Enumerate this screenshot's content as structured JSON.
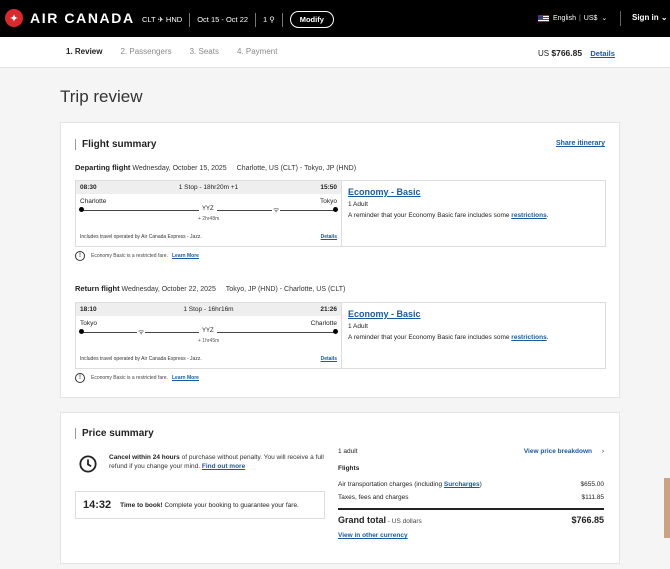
{
  "header": {
    "brand": "AIR CANADA",
    "route": "CLT ✈ HND",
    "dates": "Oct 15 - Oct 22",
    "passengers": "1",
    "modify_label": "Modify",
    "language": "English",
    "currency": "US$",
    "signin_label": "Sign in"
  },
  "steps": [
    "1. Review",
    "2. Passengers",
    "3. Seats",
    "4. Payment"
  ],
  "trip_total": {
    "prefix": "US",
    "amount": "$766.85",
    "link": "Details"
  },
  "page_title": "Trip review",
  "flight_summary": {
    "title": "Flight summary",
    "share_label": "Share itinerary",
    "flights": [
      {
        "label": "Departing flight",
        "date": "Wednesday, October 15, 2025",
        "route": "Charlotte, US (CLT) - Tokyo, JP (HND)",
        "dep_time": "08:30",
        "stops": "1 Stop - 18hr20m +1",
        "arr_time": "15:50",
        "origin": "Charlotte",
        "destination": "Tokyo",
        "via": "YYZ",
        "layover": "+ 2hr48m",
        "operator": "Includes travel operated by Air Canada Express - Jazz.",
        "details_label": "Details",
        "fare": "Economy - Basic",
        "adult": "1 Adult",
        "reminder": "A reminder that your Economy Basic fare includes some ",
        "restrictions_label": "restrictions",
        "notice": "Economy Basic is a restricted fare.",
        "learn_more": "Learn More"
      },
      {
        "label": "Return flight",
        "date": "Wednesday, October 22, 2025",
        "route": "Tokyo, JP (HND) - Charlotte, US (CLT)",
        "dep_time": "18:10",
        "stops": "1 Stop - 16hr16m",
        "arr_time": "21:26",
        "origin": "Tokyo",
        "destination": "Charlotte",
        "via": "YYZ",
        "layover": "+ 1hr45m",
        "operator": "Includes travel operated by Air Canada Express - Jazz.",
        "details_label": "Details",
        "fare": "Economy - Basic",
        "adult": "1 Adult",
        "reminder": "A reminder that your Economy Basic fare includes some ",
        "restrictions_label": "restrictions",
        "notice": "Economy Basic is a restricted fare.",
        "learn_more": "Learn More"
      }
    ]
  },
  "price_summary": {
    "title": "Price summary",
    "cancel_bold": "Cancel within 24 hours",
    "cancel_text": " of purchase without penalty. You will receive a full refund if you change your mind. ",
    "find_out_more": "Find out more",
    "timer": "14:32",
    "time_to_book": "Time to book!",
    "time_msg": " Complete your booking to guarantee your fare.",
    "adult": "1 adult",
    "breakdown_label": "View price breakdown",
    "flights_label": "Flights",
    "air_transport_label": "Air transportation charges (including ",
    "surcharges_label": "Surcharges",
    "air_transport_value": "$655.00",
    "taxes_label": "Taxes, fees and charges",
    "taxes_value": "$111.85",
    "grand_total_label": "Grand total",
    "grand_total_unit": " - US dollars",
    "grand_total_value": "$766.85",
    "other_currency_label": "View in other currency"
  },
  "colors": {
    "brand_red": "#d8292f",
    "link_blue": "#1a5aa0",
    "header_bg": "#000000"
  },
  "icons": [
    "maple-leaf-icon",
    "plane-icon",
    "person-icon",
    "us-flag-icon",
    "chevron-down-icon",
    "wifi-icon",
    "warning-icon",
    "clock-icon",
    "chevron-right-icon"
  ]
}
